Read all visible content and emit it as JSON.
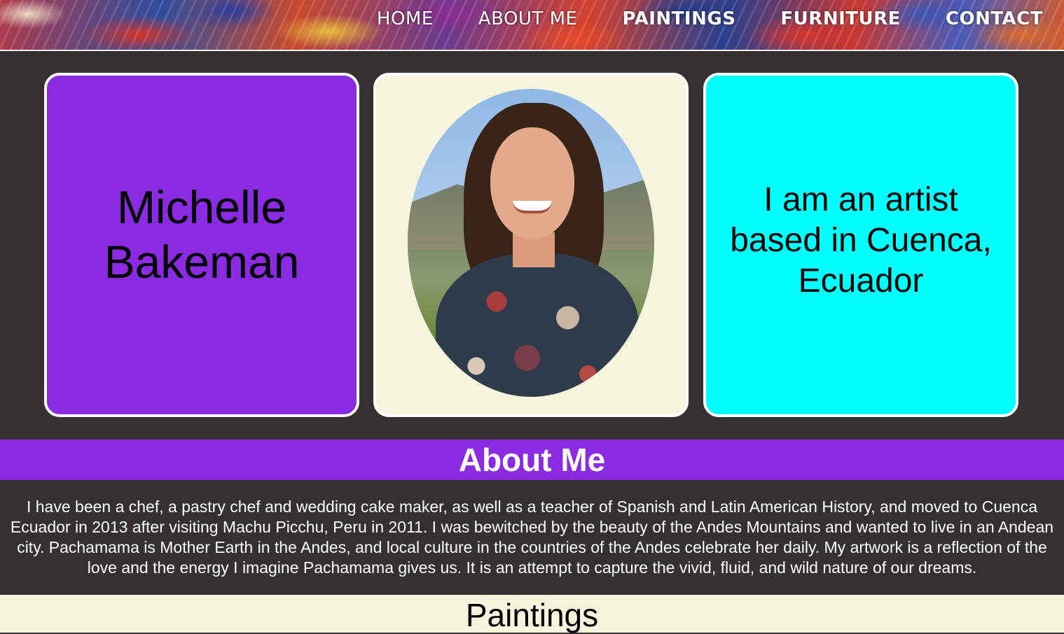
{
  "nav": {
    "items": [
      {
        "label": "HOME"
      },
      {
        "label": "ABOUT ME"
      },
      {
        "label": "PAINTINGS"
      },
      {
        "label": "FURNITURE"
      },
      {
        "label": "CONTACT"
      }
    ]
  },
  "hero": {
    "name_line1": "Michelle",
    "name_line2": "Bakeman",
    "tagline_line1": "I am an artist",
    "tagline_line2": "based in Cuenca,",
    "tagline_line3": "Ecuador"
  },
  "about": {
    "title": "About Me",
    "body": "I have been a chef, a pastry chef and wedding cake maker, as well as a teacher of Spanish and Latin American History, and moved to Cuenca Ecuador in 2013 after visiting Machu Picchu, Peru in 2011. I was bewitched by the beauty of the Andes Mountains and wanted to live in an Andean city. Pachamama is Mother Earth in the Andes, and local culture in the countries of the Andes celebrate her daily. My artwork is a reflection of the love and the energy I imagine Pachamama gives us. It is an attempt to capture the vivid, fluid, and wild nature of our dreams."
  },
  "paintings": {
    "title": "Paintings"
  },
  "colors": {
    "page_bg": "#333230",
    "accent_purple": "#8a2be2",
    "accent_cyan": "#00ffff",
    "cream": "#f5f4dc"
  }
}
